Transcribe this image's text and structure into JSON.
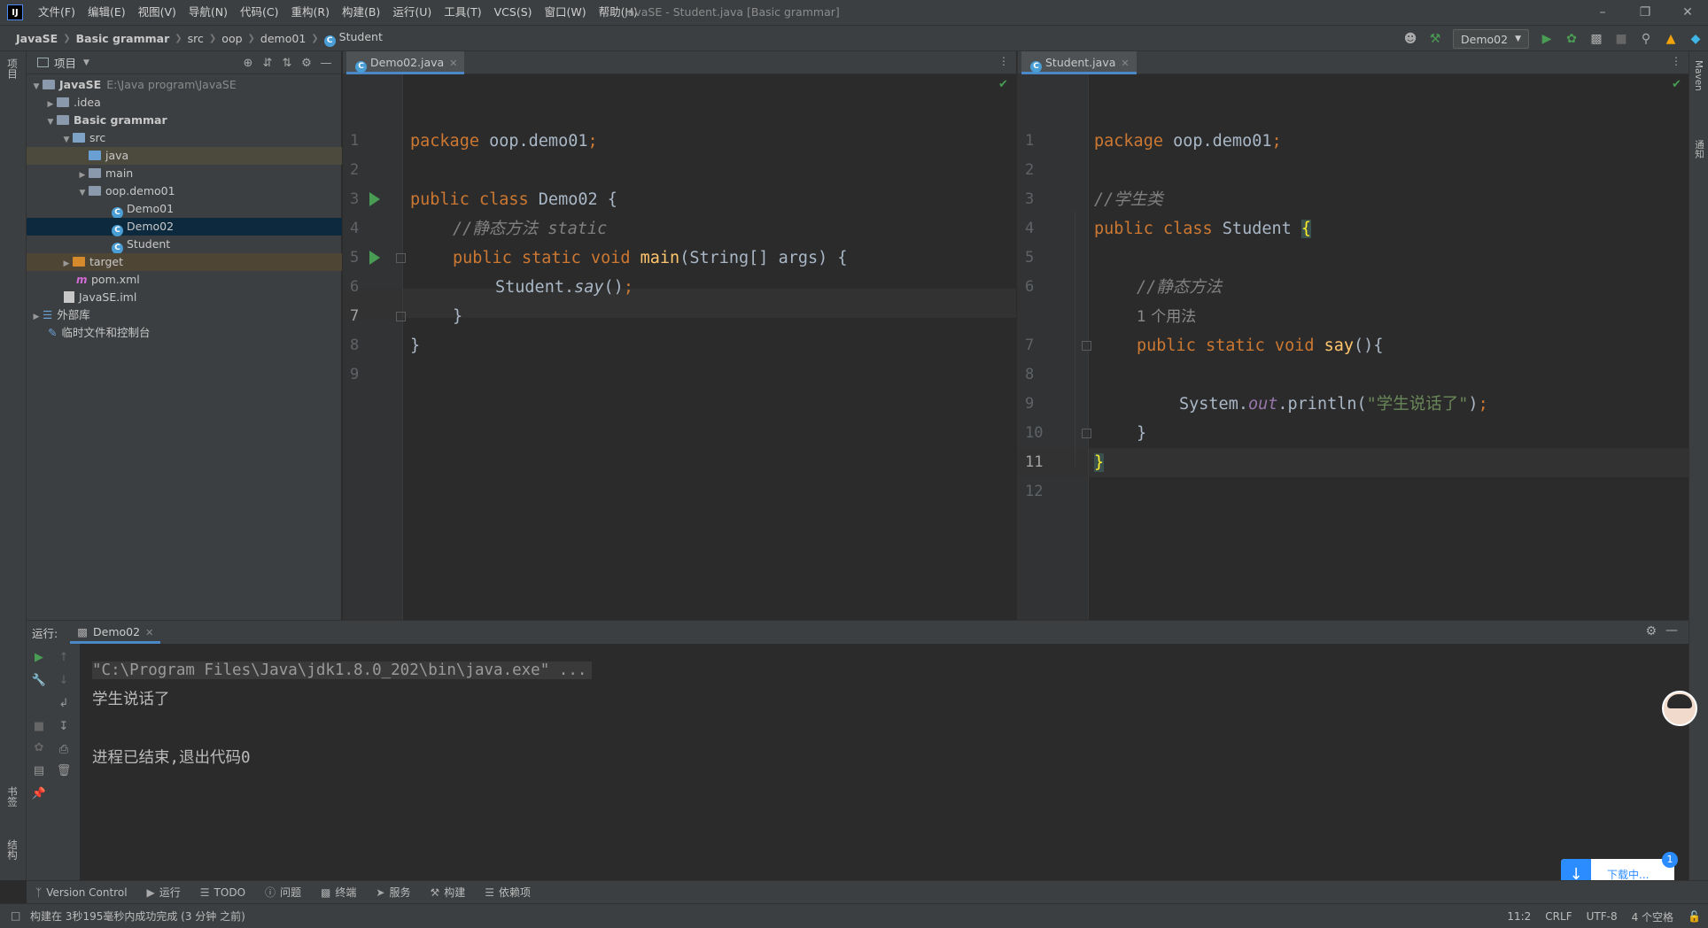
{
  "app": {
    "logo": "IJ",
    "window_title": "JavaSE - Student.java [Basic grammar]"
  },
  "menu": [
    "文件(F)",
    "编辑(E)",
    "视图(V)",
    "导航(N)",
    "代码(C)",
    "重构(R)",
    "构建(B)",
    "运行(U)",
    "工具(T)",
    "VCS(S)",
    "窗口(W)",
    "帮助(H)"
  ],
  "breadcrumb": [
    "JavaSE",
    "Basic grammar",
    "src",
    "oop",
    "demo01",
    "Student"
  ],
  "toolbar": {
    "run_config": "Demo02"
  },
  "left_strip": {
    "project": "项目",
    "bookmarks": "书签",
    "structure": "结构"
  },
  "right_strip": {
    "maven": "Maven",
    "notifications": "通知"
  },
  "project": {
    "header": "项目",
    "rows": [
      {
        "label": "JavaSE",
        "path": "E:\\Java program\\JavaSE"
      },
      {
        "label": ".idea"
      },
      {
        "label": "Basic grammar"
      },
      {
        "label": "src"
      },
      {
        "label": "java"
      },
      {
        "label": "main"
      },
      {
        "label": "oop.demo01"
      },
      {
        "label": "Demo01"
      },
      {
        "label": "Demo02"
      },
      {
        "label": "Student"
      },
      {
        "label": "target"
      },
      {
        "label": "pom.xml"
      },
      {
        "label": "JavaSE.iml"
      },
      {
        "label": "外部库"
      },
      {
        "label": "临时文件和控制台"
      }
    ]
  },
  "editor_left": {
    "tab": "Demo02.java",
    "line_numbers": [
      "1",
      "2",
      "3",
      "4",
      "5",
      "6",
      "7",
      "8",
      "9"
    ],
    "code": {
      "l1_kw": "package",
      "l1_rest": " oop.demo01",
      "l1_semi": ";",
      "l3_kw": "public class",
      "l3_rest": " Demo02 {",
      "l4": "//静态方法 static",
      "l5_kw": "public static void",
      "l5_fn": "main",
      "l5_rest": "(String[] args) {",
      "l6_a": "Student.",
      "l6_b": "say",
      "l6_c": "()",
      "l6_d": ";",
      "l7": "}",
      "l8": "}"
    }
  },
  "editor_right": {
    "tab": "Student.java",
    "line_numbers": [
      "1",
      "2",
      "3",
      "4",
      "5",
      "6",
      "7",
      "8",
      "9",
      "10",
      "11",
      "12"
    ],
    "code": {
      "l1_kw": "package",
      "l1_rest": " oop.demo01",
      "l1_semi": ";",
      "l3": "//学生类",
      "l4_kw": "public class",
      "l4_rest": " Student ",
      "l4_brace": "{",
      "l6": "//静态方法",
      "usage_hint": "1 个用法",
      "l7_kw": "public static void",
      "l7_fn": "say",
      "l7_rest": "(){",
      "l9_a": "System.",
      "l9_b": "out",
      "l9_c": ".println(",
      "l9_d": "\"学生说话了\"",
      "l9_e": ")",
      "l9_f": ";",
      "l10": "}",
      "l11": "}"
    }
  },
  "run_panel": {
    "label": "运行:",
    "tab": "Demo02",
    "console": [
      "\"C:\\Program Files\\Java\\jdk1.8.0_202\\bin\\java.exe\" ...",
      "学生说话了",
      "",
      "进程已结束,退出代码0"
    ]
  },
  "tool_tabs": [
    "Version Control",
    "运行",
    "TODO",
    "问题",
    "终端",
    "服务",
    "构建",
    "依赖项"
  ],
  "status": {
    "message": "构建在 3秒195毫秒内成功完成 (3 分钟 之前)",
    "position": "11:2",
    "line_sep": "CRLF",
    "encoding": "UTF-8",
    "indent": "4 个空格"
  },
  "download": {
    "label": "下载中...",
    "badge": "1"
  },
  "colors": {
    "keyword": "#cc7832",
    "comment": "#808080",
    "string": "#6a8759",
    "function": "#ffc66d",
    "static_field": "#9876aa",
    "accent": "#4a88c7"
  }
}
